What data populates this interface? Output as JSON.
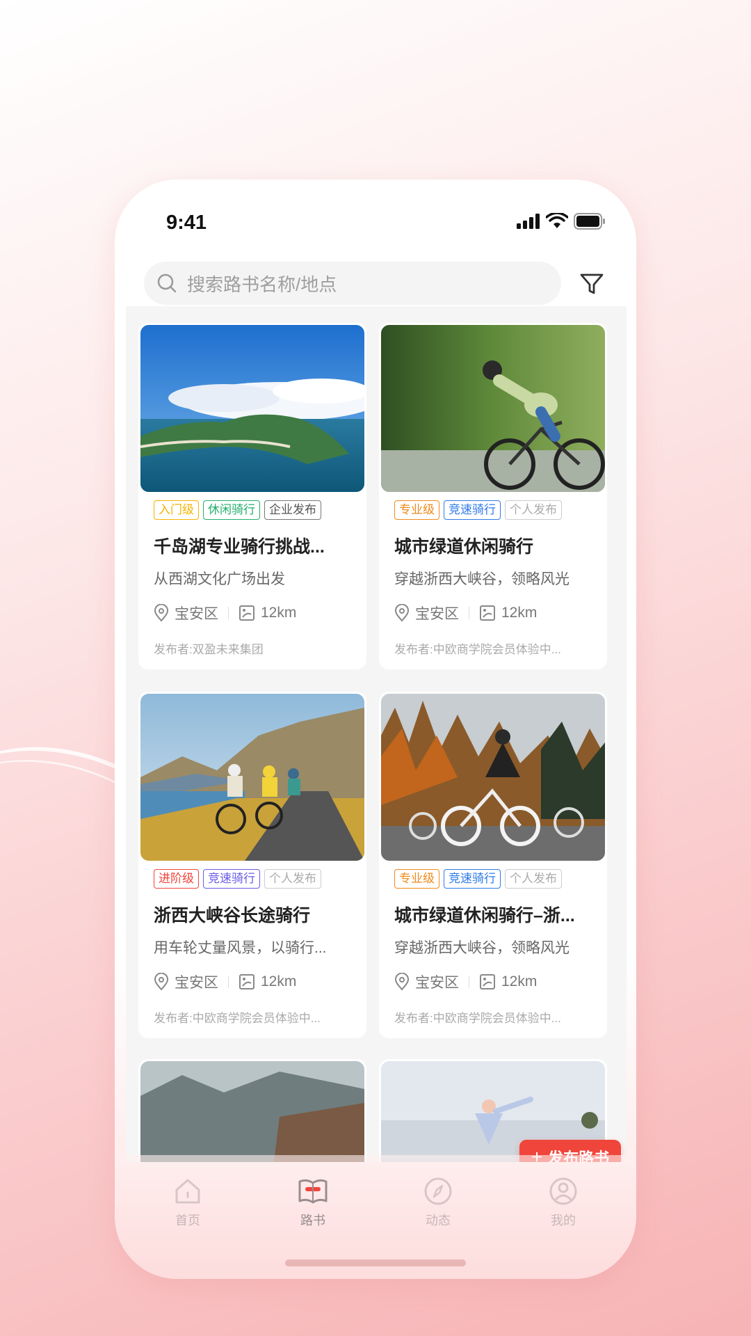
{
  "status_bar": {
    "time": "9:41"
  },
  "search": {
    "placeholder": "搜索路书名称/地点"
  },
  "cards": [
    {
      "tags": [
        {
          "text": "入门级",
          "color": "#f5b300"
        },
        {
          "text": "休闲骑行",
          "color": "#22b06b"
        },
        {
          "text": "企业发布",
          "color": "#555555"
        }
      ],
      "title": "千岛湖专业骑行挑战...",
      "subtitle": "从西湖文化广场出发",
      "location": "宝安区",
      "distance": "12km",
      "publisher": "发布者:双盈未来集团"
    },
    {
      "tags": [
        {
          "text": "专业级",
          "color": "#f08a1c"
        },
        {
          "text": "竞速骑行",
          "color": "#2f7be8"
        },
        {
          "text": "个人发布",
          "color": "#aaaaaa"
        }
      ],
      "title": "城市绿道休闲骑行",
      "subtitle": "穿越浙西大峡谷，领略风光",
      "location": "宝安区",
      "distance": "12km",
      "publisher": "发布者:中欧商学院会员体验中..."
    },
    {
      "tags": [
        {
          "text": "进阶级",
          "color": "#f0453b"
        },
        {
          "text": "竞速骑行",
          "color": "#6b5be6"
        },
        {
          "text": "个人发布",
          "color": "#aaaaaa"
        }
      ],
      "title": "浙西大峡谷长途骑行",
      "subtitle": "用车轮丈量风景，以骑行...",
      "location": "宝安区",
      "distance": "12km",
      "publisher": "发布者:中欧商学院会员体验中..."
    },
    {
      "tags": [
        {
          "text": "专业级",
          "color": "#f08a1c"
        },
        {
          "text": "竞速骑行",
          "color": "#2f7be8"
        },
        {
          "text": "个人发布",
          "color": "#aaaaaa"
        }
      ],
      "title": "城市绿道休闲骑行–浙...",
      "subtitle": "穿越浙西大峡谷，领略风光",
      "location": "宝安区",
      "distance": "12km",
      "publisher": "发布者:中欧商学院会员体验中..."
    }
  ],
  "fab": {
    "label": "发布路书"
  },
  "tabbar": [
    {
      "label": "首页",
      "icon": "home-icon"
    },
    {
      "label": "路书",
      "icon": "route-book-icon",
      "active": true
    },
    {
      "label": "动态",
      "icon": "compass-icon"
    },
    {
      "label": "我的",
      "icon": "profile-icon"
    }
  ]
}
